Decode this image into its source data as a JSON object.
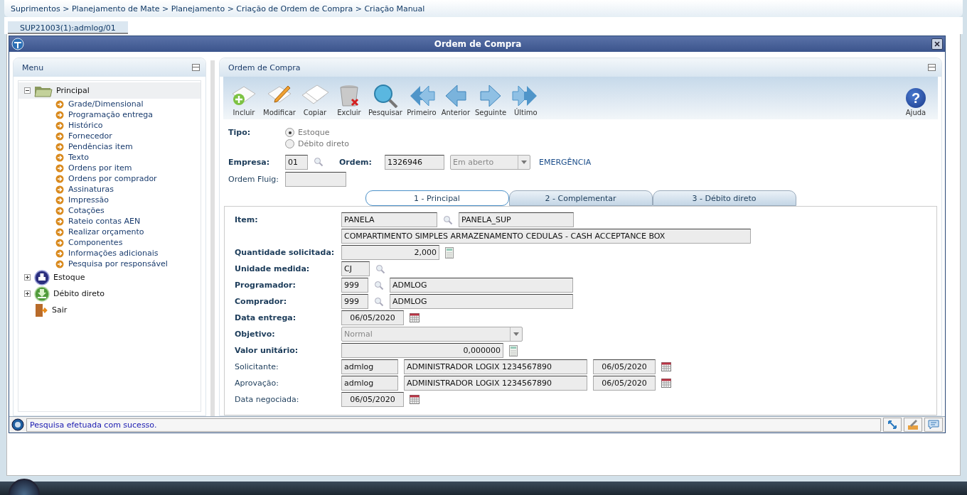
{
  "breadcrumb": "Suprimentos > Planejamento de Mate > Planejamento > Criação de Ordem de Compra > Criação Manual",
  "session_tab": {
    "label": "SUP21003(1):admlog/01",
    "selected": true
  },
  "window": {
    "title": "Ordem de Compra"
  },
  "menu": {
    "title": "Menu",
    "items": [
      {
        "label": "Principal",
        "kind": "folder",
        "expanded": true,
        "selected": true,
        "children": [
          {
            "label": "Grade/Dimensional"
          },
          {
            "label": "Programação entrega"
          },
          {
            "label": "Histórico"
          },
          {
            "label": "Fornecedor"
          },
          {
            "label": "Pendências item"
          },
          {
            "label": "Texto"
          },
          {
            "label": "Ordens por item"
          },
          {
            "label": "Ordens por comprador"
          },
          {
            "label": "Assinaturas"
          },
          {
            "label": "Impressão"
          },
          {
            "label": "Cotações"
          },
          {
            "label": "Rateio contas AEN"
          },
          {
            "label": "Realizar orçamento"
          },
          {
            "label": "Componentes"
          },
          {
            "label": "Informações adicionais"
          },
          {
            "label": "Pesquisa por responsável"
          }
        ]
      },
      {
        "label": "Estoque",
        "kind": "stock",
        "expanded": false,
        "selected": false
      },
      {
        "label": "Débito direto",
        "kind": "download",
        "expanded": false,
        "selected": false
      },
      {
        "label": "Sair",
        "kind": "exit",
        "selected": false
      }
    ]
  },
  "panel": {
    "title": "Ordem de Compra"
  },
  "toolbar": [
    {
      "label": "Incluir",
      "kind": "add"
    },
    {
      "label": "Modificar",
      "kind": "edit"
    },
    {
      "label": "Copiar",
      "kind": "copy"
    },
    {
      "label": "Excluir",
      "kind": "delete"
    },
    {
      "label": "Pesquisar",
      "kind": "search"
    },
    {
      "label": "Primeiro",
      "kind": "first"
    },
    {
      "label": "Anterior",
      "kind": "prev"
    },
    {
      "label": "Seguinte",
      "kind": "next"
    },
    {
      "label": "Último",
      "kind": "last"
    }
  ],
  "help": {
    "label": "Ajuda",
    "glyph": "?"
  },
  "header_form": {
    "tipo": {
      "label": "Tipo:",
      "options": [
        {
          "label": "Estoque",
          "selected": true
        },
        {
          "label": "Débito direto",
          "selected": false
        }
      ]
    },
    "empresa": {
      "label": "Empresa:",
      "value": "01"
    },
    "ordem": {
      "label": "Ordem:",
      "value": "1326946",
      "status": "Em aberto"
    },
    "flag": "EMERGÊNCIA",
    "ordem_fluig": {
      "label": "Ordem Fluig:"
    }
  },
  "tabs": [
    {
      "label": "1 - Principal",
      "selected": true
    },
    {
      "label": "2 - Complementar",
      "selected": false
    },
    {
      "label": "3 - Débito direto",
      "selected": false
    }
  ],
  "rows": [
    {
      "label": "Item:",
      "bold": true,
      "fields": [
        {
          "kind": "item",
          "value": "PANELA"
        },
        {
          "kind": "item-name",
          "value": "PANELA_SUP"
        }
      ]
    },
    {
      "fields": [
        {
          "kind": "desc",
          "value": "COMPARTIMENTO SIMPLES ARMAZENAMENTO CEDULAS - CASH ACCEPTANCE BOX"
        }
      ]
    },
    {
      "label": "Quantidade solicitada:",
      "bold": true,
      "fields": [
        {
          "kind": "qty",
          "value": "2,000"
        }
      ]
    },
    {
      "label": "Unidade medida:",
      "bold": true,
      "fields": [
        {
          "kind": "unit",
          "value": "CJ"
        }
      ]
    },
    {
      "label": "Programador:",
      "bold": true,
      "fields": [
        {
          "kind": "code",
          "value": "999"
        },
        {
          "kind": "name",
          "value": "ADMLOG"
        }
      ]
    },
    {
      "label": "Comprador:",
      "bold": true,
      "fields": [
        {
          "kind": "code",
          "value": "999"
        },
        {
          "kind": "name",
          "value": "ADMLOG"
        }
      ]
    },
    {
      "label": "Data entrega:",
      "bold": true,
      "fields": [
        {
          "kind": "date",
          "value": "06/05/2020"
        }
      ]
    },
    {
      "label": "Objetivo:",
      "bold": true,
      "fields": [
        {
          "kind": "select",
          "value": "Normal"
        }
      ]
    },
    {
      "label": "Valor unitário:",
      "bold": true,
      "fields": [
        {
          "kind": "value",
          "value": "0,000000"
        }
      ]
    },
    {
      "label": "Solicitante:",
      "bold": false,
      "fields": [
        {
          "kind": "login",
          "value": "admlog"
        },
        {
          "kind": "fullname",
          "value": "ADMINISTRADOR LOGIX 1234567890"
        },
        {
          "kind": "date",
          "value": "06/05/2020"
        }
      ]
    },
    {
      "label": "Aprovação:",
      "bold": false,
      "fields": [
        {
          "kind": "login",
          "value": "admlog"
        },
        {
          "kind": "fullname",
          "value": "ADMINISTRADOR LOGIX 1234567890"
        },
        {
          "kind": "date",
          "value": "06/05/2020"
        }
      ]
    },
    {
      "label": "Data negociada:",
      "bold": false,
      "fields": [
        {
          "kind": "date",
          "value": "06/05/2020"
        }
      ]
    }
  ],
  "status_bar": {
    "message": "Pesquisa efetuada com sucesso."
  }
}
